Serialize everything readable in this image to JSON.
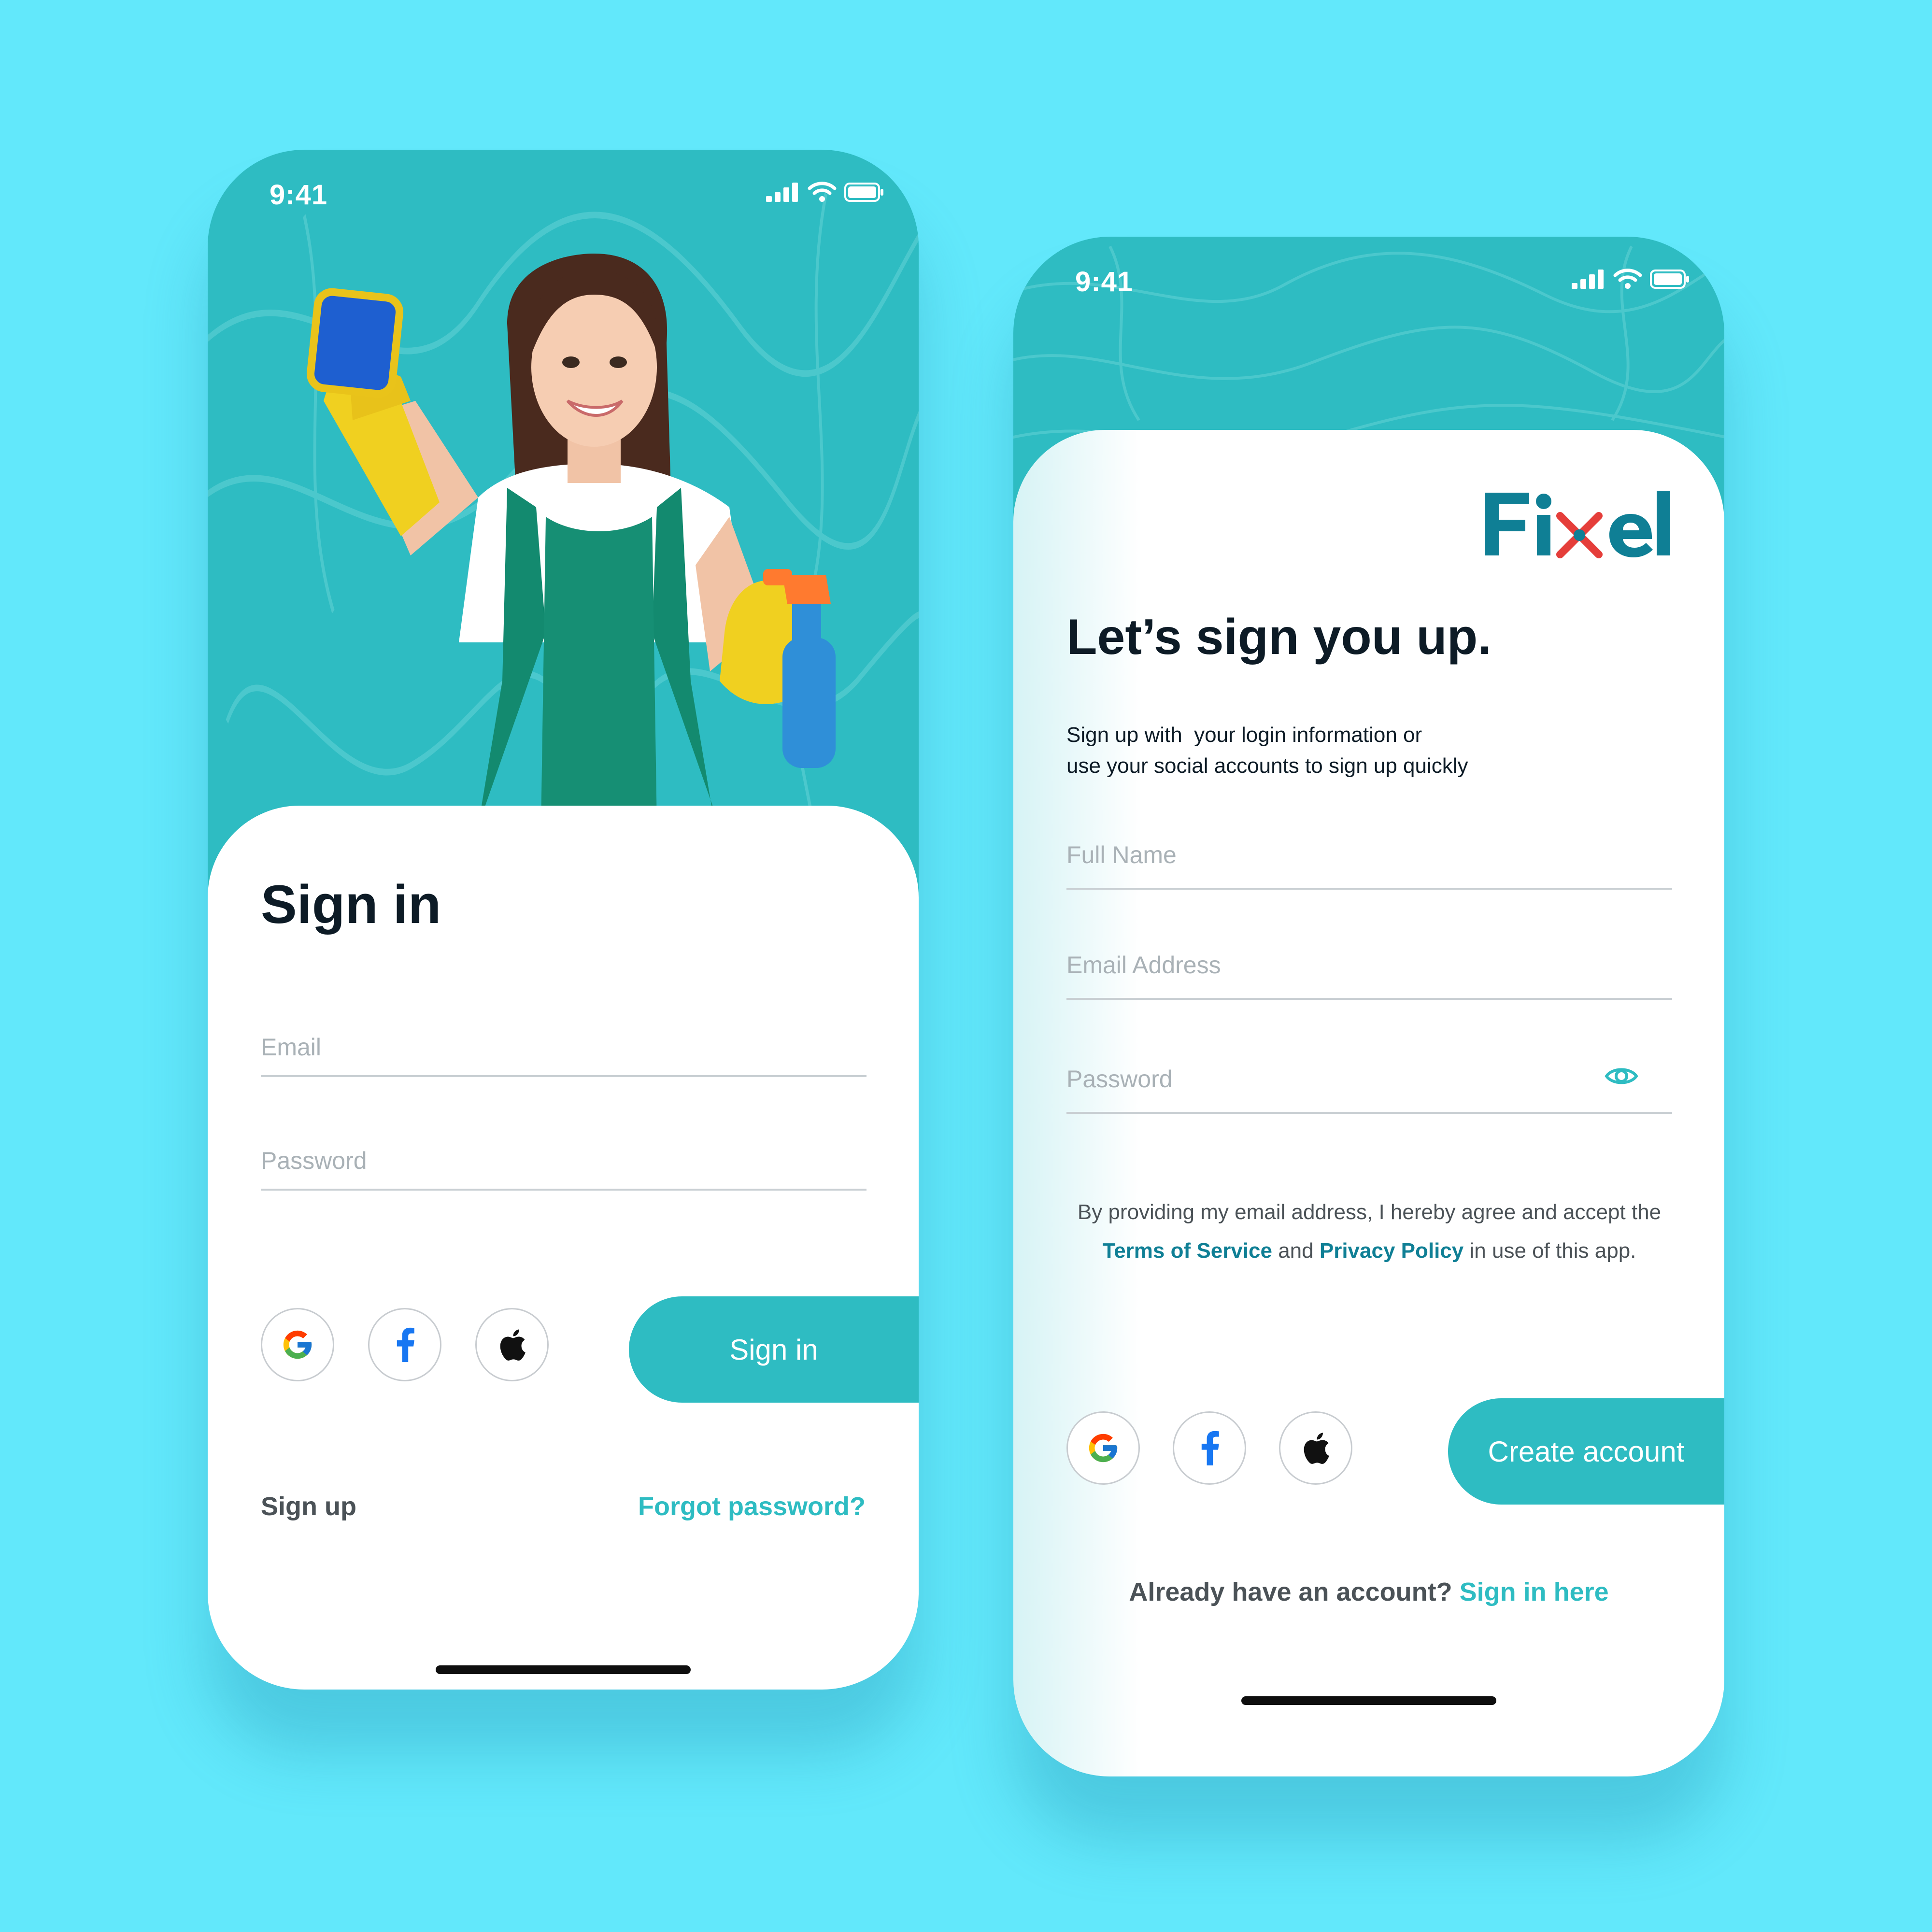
{
  "colors": {
    "background": "#62e8fb",
    "accent": "#2ebcc2",
    "heading": "#0d1b26",
    "muted_text": "#a9b1b6",
    "link_dark": "#0f7f95",
    "logo_blue": "#0f7f95",
    "logo_red": "#e53e3a"
  },
  "signin_screen": {
    "status": {
      "time": "9:41"
    },
    "title": "Sign in",
    "email_placeholder": "Email",
    "password_placeholder": "Password",
    "social_icons": [
      "google-icon",
      "facebook-icon",
      "apple-icon"
    ],
    "signin_button": "Sign in",
    "sign_up_link": "Sign up",
    "forgot_password_link": "Forgot password?"
  },
  "signup_screen": {
    "status": {
      "time": "9:41"
    },
    "logo_text": "Fixel",
    "title": "Let’s sign you up.",
    "subtitle_line1": "Sign up with  your login information or",
    "subtitle_line2": "use your social accounts to sign up quickly",
    "fullname_placeholder": "Full Name",
    "email_placeholder": "Email Address",
    "password_placeholder": "Password",
    "terms_prefix": "By providing my email address, I hereby agree and accept the",
    "terms_link": "Terms of Service",
    "terms_and": "and",
    "privacy_link": "Privacy Policy",
    "terms_suffix": "in use of this app.",
    "social_icons": [
      "google-icon",
      "facebook-icon",
      "apple-icon"
    ],
    "create_button": "Create account",
    "have_account_text": "Already have an account?",
    "signin_here_link": "Sign in here"
  }
}
